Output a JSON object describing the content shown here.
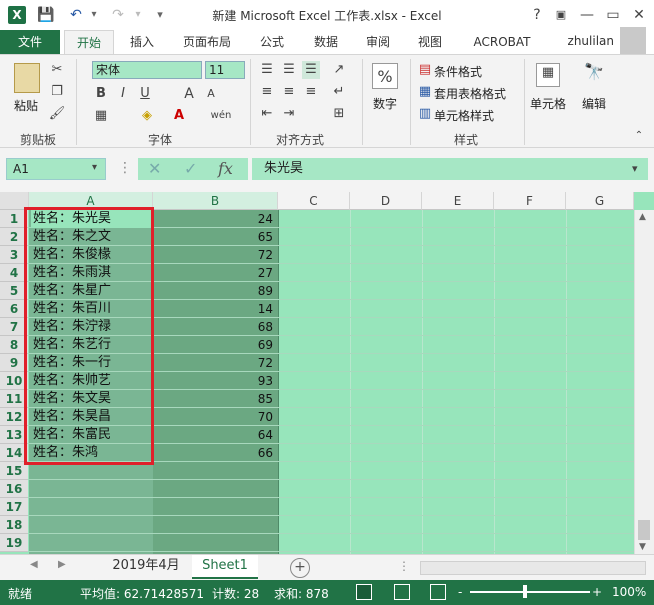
{
  "window": {
    "title": "新建 Microsoft Excel 工作表.xlsx - Excel",
    "app_icon": "X",
    "minimize": "—",
    "restore": "▭",
    "close": "✕",
    "help": "?"
  },
  "quick_access": {
    "save": "💾",
    "undo": "↶",
    "redo": "↷"
  },
  "tabs": [
    "文件",
    "开始",
    "插入",
    "页面布局",
    "公式",
    "数据",
    "审阅",
    "视图",
    "ACROBAT"
  ],
  "active_tab": "开始",
  "user": "zhulilan",
  "ribbon": {
    "clipboard": {
      "paste": "粘贴",
      "label": "剪贴板"
    },
    "font": {
      "name": "宋体",
      "size": "11",
      "bold": "B",
      "italic": "I",
      "underline": "U",
      "label": "字体",
      "font_grow": "A",
      "font_shrink": "A",
      "wen": "wén"
    },
    "alignment": {
      "label": "对齐方式"
    },
    "number": {
      "label": "数字",
      "icon": "%"
    },
    "styles": {
      "cond": "条件格式",
      "table": "套用表格格式",
      "cell": "单元格样式",
      "label": "样式"
    },
    "cells": {
      "label": "单元格"
    },
    "editing": {
      "label": "编辑"
    }
  },
  "formula_bar": {
    "name_box": "A1",
    "fx": "fx",
    "cancel": "✕",
    "confirm": "✓",
    "content": "朱光昊"
  },
  "columns": [
    "A",
    "B",
    "C",
    "D",
    "E",
    "F",
    "G"
  ],
  "rows": [
    {
      "n": "1",
      "a": "姓名：朱光昊",
      "b": "24"
    },
    {
      "n": "2",
      "a": "姓名：朱之文",
      "b": "65"
    },
    {
      "n": "3",
      "a": "姓名：朱俊椽",
      "b": "72"
    },
    {
      "n": "4",
      "a": "姓名：朱雨淇",
      "b": "27"
    },
    {
      "n": "5",
      "a": "姓名：朱星广",
      "b": "89"
    },
    {
      "n": "6",
      "a": "姓名：朱百川",
      "b": "14"
    },
    {
      "n": "7",
      "a": "姓名：朱泞禄",
      "b": "68"
    },
    {
      "n": "8",
      "a": "姓名：朱艺行",
      "b": "69"
    },
    {
      "n": "9",
      "a": "姓名：朱一行",
      "b": "72"
    },
    {
      "n": "10",
      "a": "姓名：朱帅艺",
      "b": "93"
    },
    {
      "n": "11",
      "a": "姓名：朱文昊",
      "b": "85"
    },
    {
      "n": "12",
      "a": "姓名：朱昊昌",
      "b": "70"
    },
    {
      "n": "13",
      "a": "姓名：朱富民",
      "b": "64"
    },
    {
      "n": "14",
      "a": "姓名：朱鸿",
      "b": "66"
    },
    {
      "n": "15",
      "a": "",
      "b": ""
    },
    {
      "n": "16",
      "a": "",
      "b": ""
    },
    {
      "n": "17",
      "a": "",
      "b": ""
    },
    {
      "n": "18",
      "a": "",
      "b": ""
    },
    {
      "n": "19",
      "a": "",
      "b": ""
    }
  ],
  "sheets": [
    "2019年4月",
    "Sheet1"
  ],
  "active_sheet": "Sheet1",
  "add_sheet": "+",
  "status": {
    "mode": "就绪",
    "average": "平均值: 62.71428571",
    "count": "计数: 28",
    "sum": "求和: 878",
    "zoom": "100%",
    "zoom_minus": "-",
    "zoom_plus": "+"
  }
}
